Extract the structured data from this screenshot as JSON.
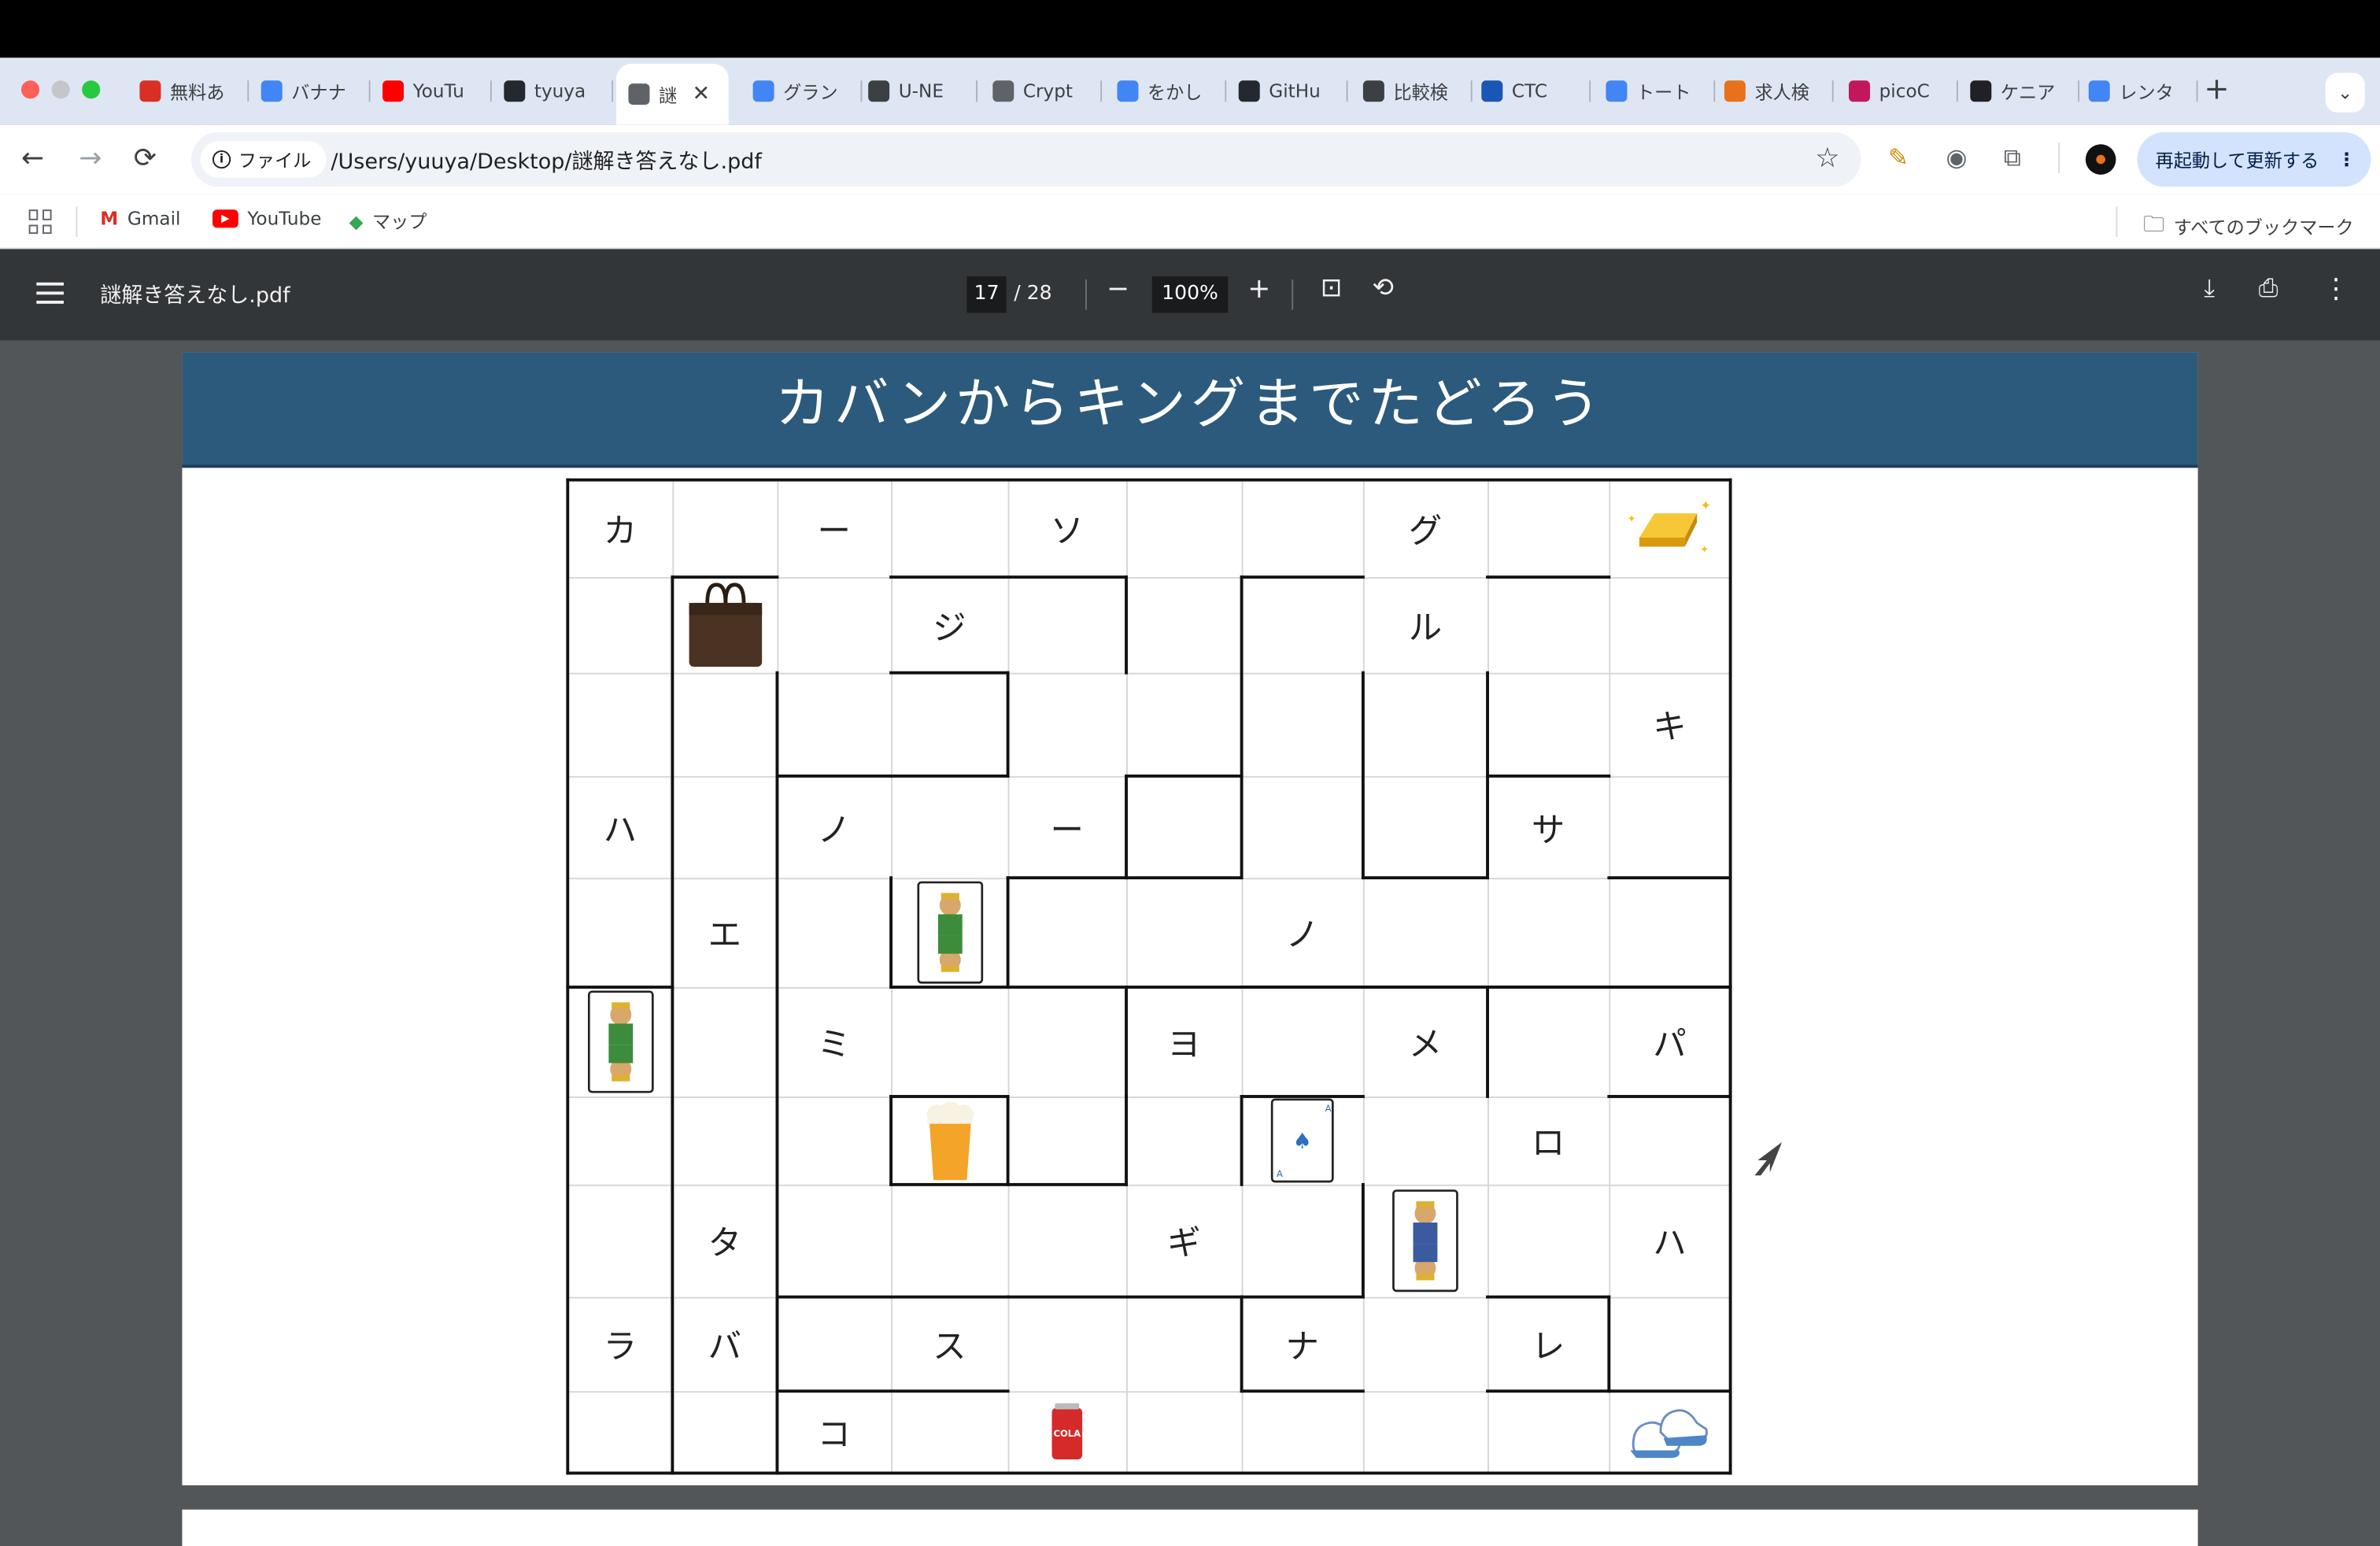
{
  "tabs": [
    {
      "label": "無料あ",
      "icon": "nazo-kanji-icon",
      "color": "#d93025"
    },
    {
      "label": "バナナ",
      "icon": "google-icon",
      "color": "#4285f4"
    },
    {
      "label": "YouTu",
      "icon": "youtube-icon",
      "color": "#ff0000"
    },
    {
      "label": "tyuya",
      "icon": "github-icon",
      "color": "#24292f"
    },
    {
      "label": "謎",
      "icon": "globe-icon",
      "color": "#5f6368",
      "active": true
    },
    {
      "label": "グラン",
      "icon": "google-icon",
      "color": "#4285f4"
    },
    {
      "label": "U-NE",
      "icon": "shield-icon",
      "color": "#3c4043"
    },
    {
      "label": "Crypt",
      "icon": "crypto-icon",
      "color": "#5f6368"
    },
    {
      "label": "をかし",
      "icon": "google-icon",
      "color": "#4285f4"
    },
    {
      "label": "GitHu",
      "icon": "github-icon",
      "color": "#24292f"
    },
    {
      "label": "比較検",
      "icon": "scales-icon",
      "color": "#3c4043"
    },
    {
      "label": "CTC",
      "icon": "ctc-icon",
      "color": "#1a56b4"
    },
    {
      "label": "トート",
      "icon": "google-icon",
      "color": "#4285f4"
    },
    {
      "label": "求人検",
      "icon": "orange-logo-icon",
      "color": "#e8711c"
    },
    {
      "label": "picoC",
      "icon": "pico-icon",
      "color": "#c2185b"
    },
    {
      "label": "ケニア",
      "icon": "openai-icon",
      "color": "#202124"
    },
    {
      "label": "レンタ",
      "icon": "google-icon",
      "color": "#4285f4"
    }
  ],
  "active_tab_close": "✕",
  "new_tab": "+",
  "tab_menu": "⌄",
  "toolbar": {
    "back": "←",
    "forward": "→",
    "reload": "⟳",
    "chip_label": "ファイル",
    "url": "/Users/yuuya/Desktop/謎解き答えなし.pdf",
    "relaunch_label": "再起動して更新する"
  },
  "bookmarks": {
    "items": [
      "Gmail",
      "YouTube",
      "マップ"
    ],
    "all": "すべてのブックマーク"
  },
  "pdf": {
    "filename": "謎解き答えなし.pdf",
    "page": "17",
    "total": "/ 28",
    "zoom": "100%"
  },
  "puzzle": {
    "title": "カバンからキングまでたどろう",
    "grid": [
      [
        "カ",
        "",
        "ー",
        "",
        "ソ",
        "",
        "",
        "グ",
        "",
        "[gold-bar]"
      ],
      [
        "",
        "[bag]",
        "",
        "ジ",
        "",
        "",
        "",
        "ル",
        "",
        ""
      ],
      [
        "",
        "",
        "",
        "",
        "",
        "",
        "",
        "",
        "",
        "キ"
      ],
      [
        "ハ",
        "",
        "ノ",
        "",
        "ー",
        "",
        "",
        "",
        "サ",
        ""
      ],
      [
        "",
        "エ",
        "",
        "[queen-card]",
        "",
        "",
        "ノ",
        "",
        "",
        ""
      ],
      [
        "[jack-card]",
        "",
        "ミ",
        "",
        "",
        "ヨ",
        "",
        "メ",
        "",
        "パ"
      ],
      [
        "",
        "",
        "",
        "[beer]",
        "",
        "",
        "[ace-of-spades]",
        "",
        "ロ",
        ""
      ],
      [
        "",
        "タ",
        "",
        "",
        "",
        "ギ",
        "",
        "[king-card]",
        "",
        "ハ"
      ],
      [
        "ラ",
        "バ",
        "",
        "ス",
        "",
        "",
        "ナ",
        "",
        "レ",
        ""
      ],
      [
        "",
        "",
        "コ",
        "",
        "[cola-can]",
        "",
        "",
        "",
        "",
        "[sneakers]"
      ]
    ]
  }
}
